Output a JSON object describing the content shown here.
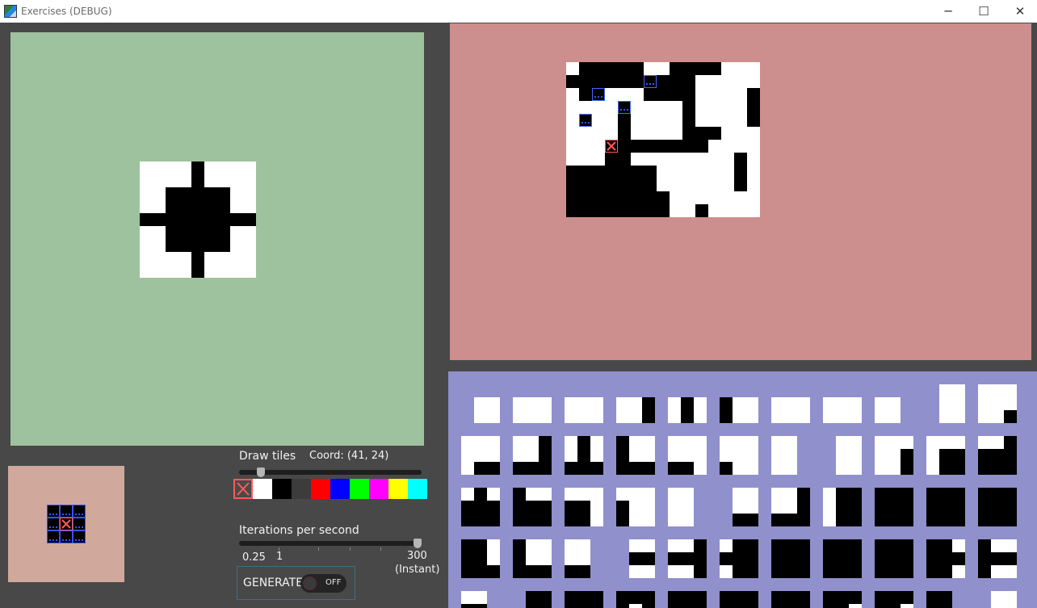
{
  "window": {
    "title": "Exercises (DEBUG)",
    "minimize_glyph": "─",
    "maximize_glyph": "☐",
    "close_glyph": "✕"
  },
  "colors": {
    "input_bg": "#9ec29e",
    "output_bg": "#cd8e8e",
    "tiles_bg": "#9090cc",
    "pattern_bg": "#d0a89c",
    "accent_red": "#ff5a5a",
    "accent_blue": "#3355ff"
  },
  "draw_tiles": {
    "label": "Draw tiles",
    "coord_text": "Coord: (41, 24)",
    "slider_value": 0.1,
    "palette": [
      {
        "name": "eraser",
        "color": "#4a4a4a",
        "selected": true
      },
      {
        "name": "white",
        "color": "#ffffff"
      },
      {
        "name": "black",
        "color": "#000000"
      },
      {
        "name": "dark-gray",
        "color": "#3c3c3c"
      },
      {
        "name": "red",
        "color": "#ff0000"
      },
      {
        "name": "blue",
        "color": "#0000ff"
      },
      {
        "name": "green",
        "color": "#00ff00"
      },
      {
        "name": "magenta",
        "color": "#ff00ff"
      },
      {
        "name": "yellow",
        "color": "#ffff00"
      },
      {
        "name": "cyan",
        "color": "#00ffff"
      }
    ]
  },
  "iterations": {
    "label": "Iterations per second",
    "min_label": "0.25",
    "one_label": "1",
    "max_label": "300",
    "instant_label": "(Instant)",
    "slider_value": 1.0
  },
  "generate": {
    "label": "GENERATE",
    "toggle_text": "OFF"
  }
}
